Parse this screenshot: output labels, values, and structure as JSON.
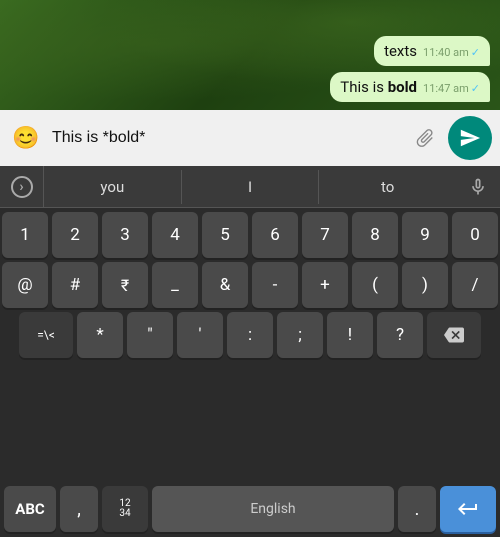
{
  "chat": {
    "messages": [
      {
        "text_before_bold": "texts",
        "bold_text": "",
        "text_after_bold": "",
        "full_text": "texts",
        "time": "11:40 am",
        "has_check": true
      },
      {
        "text_before_bold": "This is ",
        "bold_text": "bold",
        "text_after_bold": "",
        "full_text": "This is bold",
        "time": "11:47 am",
        "has_check": true
      }
    ]
  },
  "input_bar": {
    "placeholder": "This is *bold*",
    "emoji_icon": "😊",
    "attach_label": "attach",
    "send_label": "send"
  },
  "keyboard": {
    "suggestions": {
      "arrow_label": ">",
      "items": [
        "you",
        "I",
        "to"
      ],
      "mic_label": "mic"
    },
    "rows": {
      "numbers": [
        "1",
        "2",
        "3",
        "4",
        "5",
        "6",
        "7",
        "8",
        "9",
        "0"
      ],
      "symbols1": [
        "@",
        "#",
        "₹",
        "_",
        "&",
        "-",
        "+",
        "(",
        ")",
        "/"
      ],
      "symbols2": [
        "=\\<",
        "*",
        "\"",
        "'",
        ":",
        ";",
        "!",
        "?",
        "⌫"
      ]
    },
    "bottom": {
      "abc_label": "ABC",
      "comma_label": ",",
      "numbers_label_top": "12",
      "numbers_label_bottom": "34",
      "space_label": "English",
      "period_label": ".",
      "enter_label": "↵"
    }
  }
}
